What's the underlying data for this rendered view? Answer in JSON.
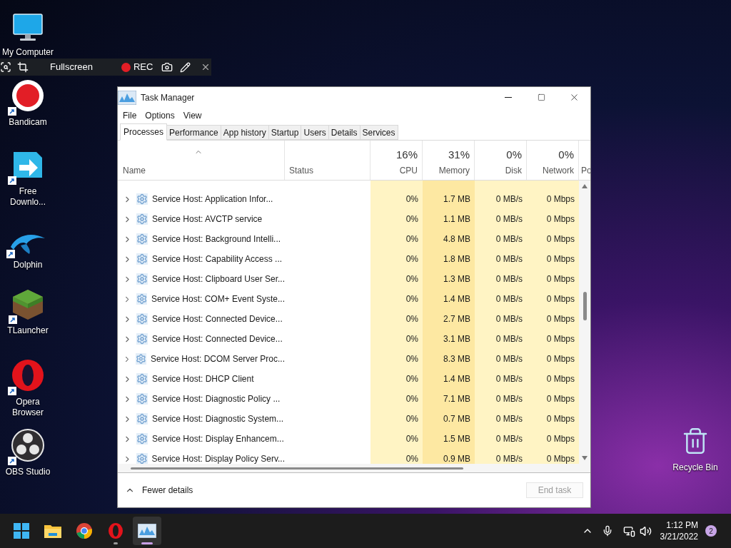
{
  "desktop_icons": [
    {
      "kind": "computer",
      "label": "My Computer",
      "shortcut": false
    },
    {
      "kind": "bandicam",
      "label": "Bandicam",
      "shortcut": true
    },
    {
      "kind": "download",
      "label": "Free Downlo...",
      "shortcut": true
    },
    {
      "kind": "dolphin",
      "label": "Dolphin",
      "shortcut": true
    },
    {
      "kind": "grass",
      "label": "TLauncher",
      "shortcut": true
    },
    {
      "kind": "opera",
      "label": "Opera Browser",
      "shortcut": true
    },
    {
      "kind": "obs",
      "label": "OBS Studio",
      "shortcut": true
    }
  ],
  "recycle_bin": {
    "label": "Recycle Bin"
  },
  "recorder_bar": {
    "mode": "Fullscreen",
    "rec": "REC"
  },
  "window": {
    "title": "Task Manager",
    "menu": [
      "File",
      "Options",
      "View"
    ],
    "tabs": [
      {
        "label": "Processes",
        "selected": true
      },
      {
        "label": "Performance",
        "selected": false
      },
      {
        "label": "App history",
        "selected": false
      },
      {
        "label": "Startup",
        "selected": false
      },
      {
        "label": "Users",
        "selected": false
      },
      {
        "label": "Details",
        "selected": false
      },
      {
        "label": "Services",
        "selected": false
      }
    ],
    "columns": [
      {
        "label": "Name"
      },
      {
        "label": "Status"
      },
      {
        "label": "CPU",
        "summary": "16%"
      },
      {
        "label": "Memory",
        "summary": "31%"
      },
      {
        "label": "Disk",
        "summary": "0%"
      },
      {
        "label": "Network",
        "summary": "0%"
      },
      {
        "label": "Po"
      }
    ],
    "rows": [
      {
        "name": "Service Host: Application Infor...",
        "cpu": "0%",
        "memory": "1.7 MB",
        "disk": "0 MB/s",
        "network": "0 Mbps"
      },
      {
        "name": "Service Host: AVCTP service",
        "cpu": "0%",
        "memory": "1.1 MB",
        "disk": "0 MB/s",
        "network": "0 Mbps"
      },
      {
        "name": "Service Host: Background Intelli...",
        "cpu": "0%",
        "memory": "4.8 MB",
        "disk": "0 MB/s",
        "network": "0 Mbps"
      },
      {
        "name": "Service Host: Capability Access ...",
        "cpu": "0%",
        "memory": "1.8 MB",
        "disk": "0 MB/s",
        "network": "0 Mbps"
      },
      {
        "name": "Service Host: Clipboard User Ser...",
        "cpu": "0%",
        "memory": "1.3 MB",
        "disk": "0 MB/s",
        "network": "0 Mbps"
      },
      {
        "name": "Service Host: COM+ Event Syste...",
        "cpu": "0%",
        "memory": "1.4 MB",
        "disk": "0 MB/s",
        "network": "0 Mbps"
      },
      {
        "name": "Service Host: Connected Device...",
        "cpu": "0%",
        "memory": "2.7 MB",
        "disk": "0 MB/s",
        "network": "0 Mbps"
      },
      {
        "name": "Service Host: Connected Device...",
        "cpu": "0%",
        "memory": "3.1 MB",
        "disk": "0 MB/s",
        "network": "0 Mbps"
      },
      {
        "name": "Service Host: DCOM Server Proc...",
        "cpu": "0%",
        "memory": "8.3 MB",
        "disk": "0 MB/s",
        "network": "0 Mbps"
      },
      {
        "name": "Service Host: DHCP Client",
        "cpu": "0%",
        "memory": "1.4 MB",
        "disk": "0 MB/s",
        "network": "0 Mbps"
      },
      {
        "name": "Service Host: Diagnostic Policy ...",
        "cpu": "0%",
        "memory": "7.1 MB",
        "disk": "0 MB/s",
        "network": "0 Mbps"
      },
      {
        "name": "Service Host: Diagnostic System...",
        "cpu": "0%",
        "memory": "0.7 MB",
        "disk": "0 MB/s",
        "network": "0 Mbps"
      },
      {
        "name": "Service Host: Display Enhancem...",
        "cpu": "0%",
        "memory": "1.5 MB",
        "disk": "0 MB/s",
        "network": "0 Mbps"
      },
      {
        "name": "Service Host: Display Policy Serv...",
        "cpu": "0%",
        "memory": "0.9 MB",
        "disk": "0 MB/s",
        "network": "0 Mbps"
      }
    ],
    "footer": {
      "toggle": "Fewer details",
      "end_task": "End task",
      "end_task_disabled": true
    }
  },
  "taskbar": {
    "apps": [
      {
        "kind": "start",
        "running": false,
        "active": false
      },
      {
        "kind": "explorer",
        "running": false,
        "active": false
      },
      {
        "kind": "chrome",
        "running": false,
        "active": false
      },
      {
        "kind": "opera",
        "running": true,
        "active": false
      },
      {
        "kind": "taskmanager",
        "running": true,
        "active": true
      }
    ],
    "time": "1:12 PM",
    "date": "3/21/2022",
    "notifications": "2"
  }
}
